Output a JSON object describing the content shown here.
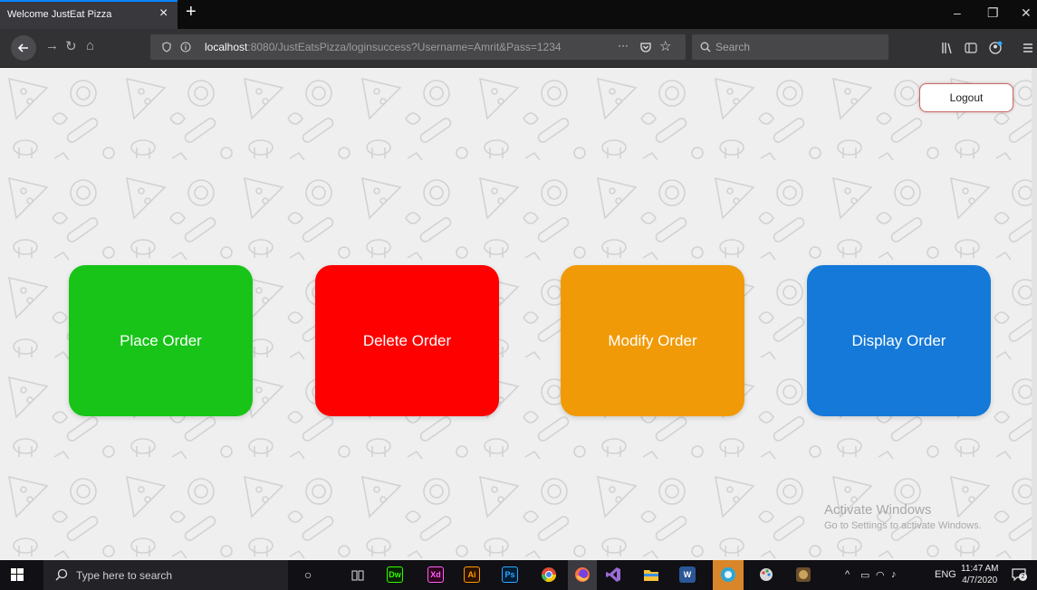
{
  "browser": {
    "tab_title": "Welcome JustEat Pizza",
    "tab_close": "×",
    "new_tab": "+",
    "url_host": "localhost",
    "url_rest": ":8080/JustEatsPizza/loginsuccess?Username=Amrit&Pass=1234",
    "url_menu": "···",
    "search_placeholder": "Search",
    "window_controls": [
      "–",
      "❐",
      "✕"
    ]
  },
  "page": {
    "logout_label": "Logout",
    "cards": [
      {
        "label": "Place Order",
        "color": "#17c417"
      },
      {
        "label": "Delete Order",
        "color": "#ff0000"
      },
      {
        "label": "Modify Order",
        "color": "#f19a08"
      },
      {
        "label": "Display Order",
        "color": "#1479d8"
      }
    ],
    "watermark_line1": "Activate Windows",
    "watermark_line2": "Go to Settings to activate Windows."
  },
  "taskbar": {
    "search_placeholder": "Type here to search",
    "apps": [
      "Dw",
      "Xd",
      "Ai",
      "Ps"
    ],
    "tray_lang": "ENG",
    "time": "11:47 AM",
    "date": "4/7/2020",
    "notification_count": "2"
  }
}
